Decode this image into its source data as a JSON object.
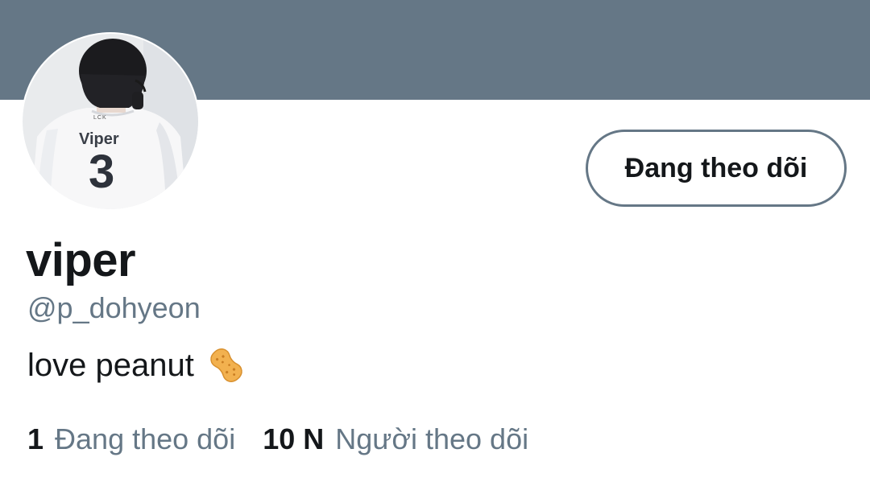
{
  "profile": {
    "display_name": "viper",
    "handle": "@p_dohyeon",
    "bio": "love peanut",
    "bio_emoji": "peanut-emoji",
    "avatar": {
      "jersey_name": "Viper",
      "jersey_number": "3",
      "jersey_logo": "LCK"
    },
    "follow_button_label": "Đang theo dõi"
  },
  "stats": {
    "following_count": "1",
    "following_label": "Đang theo dõi",
    "followers_count": "10 N",
    "followers_label": "Người theo dõi"
  },
  "colors": {
    "banner": "#657786",
    "text_primary": "#14171a",
    "text_secondary": "#657786"
  }
}
